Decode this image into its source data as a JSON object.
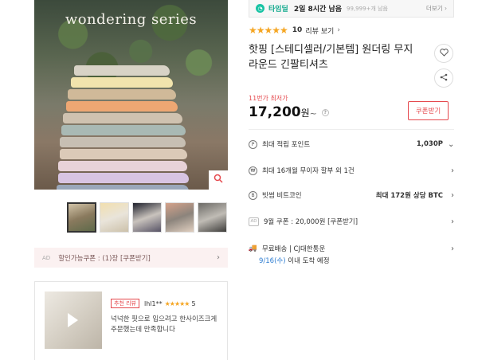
{
  "main_image": {
    "caption": "wondering series",
    "sweater_colors": [
      "#d8d3c6",
      "#f1e4ad",
      "#d0b999",
      "#eea773",
      "#cfc2b0",
      "#a9b9b4",
      "#c7bfb3",
      "#dbcab8",
      "#e8d2d8",
      "#d8c4e2",
      "#9aa7ba",
      "#2d2f36",
      "#4b3a34"
    ],
    "zoom_icon": "magnifier-icon"
  },
  "thumbnails": [
    {
      "colors": [
        "#d2c4a8",
        "#8a7a5e",
        "#5e6a4a"
      ]
    },
    {
      "colors": [
        "#f2dfae",
        "#e9e4da",
        "#ccc1aa"
      ]
    },
    {
      "colors": [
        "#1d1f2b",
        "#c9c3bd",
        "#575366"
      ]
    },
    {
      "colors": [
        "#d5a28a",
        "#8c847c",
        "#e0cfc0"
      ]
    },
    {
      "colors": [
        "#6c6a66",
        "#c0bcb5",
        "#3e3d3b"
      ]
    }
  ],
  "ad_coupon": {
    "ad_label": "AD",
    "text": "할인가능쿠폰 : (1)장 [쿠폰받기]"
  },
  "review": {
    "badge": "추천 리뷰",
    "user": "lhl1**",
    "stars": "★★★★★",
    "score": "5",
    "text": "넉넉한 핏으로 입으려고 한사이즈크게 주문했는데 만족합니다"
  },
  "timedeal": {
    "icon": "clock-icon",
    "title": "타임딜",
    "time_left": "2일 8시간 남음",
    "sold": "99,999+개 남음",
    "more": "더보기 ›"
  },
  "rating": {
    "stars": "★★★★★",
    "count": "10",
    "link": "리뷰 보기",
    "chevron": "›"
  },
  "product": {
    "title": "핫핑 [스테디셀러/기본템] 원더링 무지 라운드 긴팔티셔츠",
    "like_icon": "heart-icon",
    "share_icon": "share-icon"
  },
  "price": {
    "label": "11번가 최저가",
    "amount": "17,200",
    "unit": "원",
    "tilde": "~",
    "info": "?",
    "coupon_button": "쿠폰받기"
  },
  "info_rows": [
    {
      "icon": "P",
      "label": "최대 적립 포인트",
      "value": "1,030P",
      "chevron": "⌄"
    },
    {
      "icon": "₩",
      "label": "최대 16개월 무이자 할부 외 1건",
      "value": "",
      "chevron": "›"
    },
    {
      "icon": "B",
      "label": "빗썸 비트코인",
      "value": "최대 172원 상당 BTC",
      "chevron": "›"
    },
    {
      "icon": "AD",
      "label": "9월 쿠폰 : 20,000원 [쿠폰받기]",
      "value": "",
      "chevron": "›"
    },
    {
      "icon": "🚚",
      "label": "무료배송 | CJ대한통운",
      "value": "",
      "chevron": "›"
    }
  ],
  "delivery": {
    "date": "9/16(수)",
    "text": " 이내 도착 예정"
  }
}
